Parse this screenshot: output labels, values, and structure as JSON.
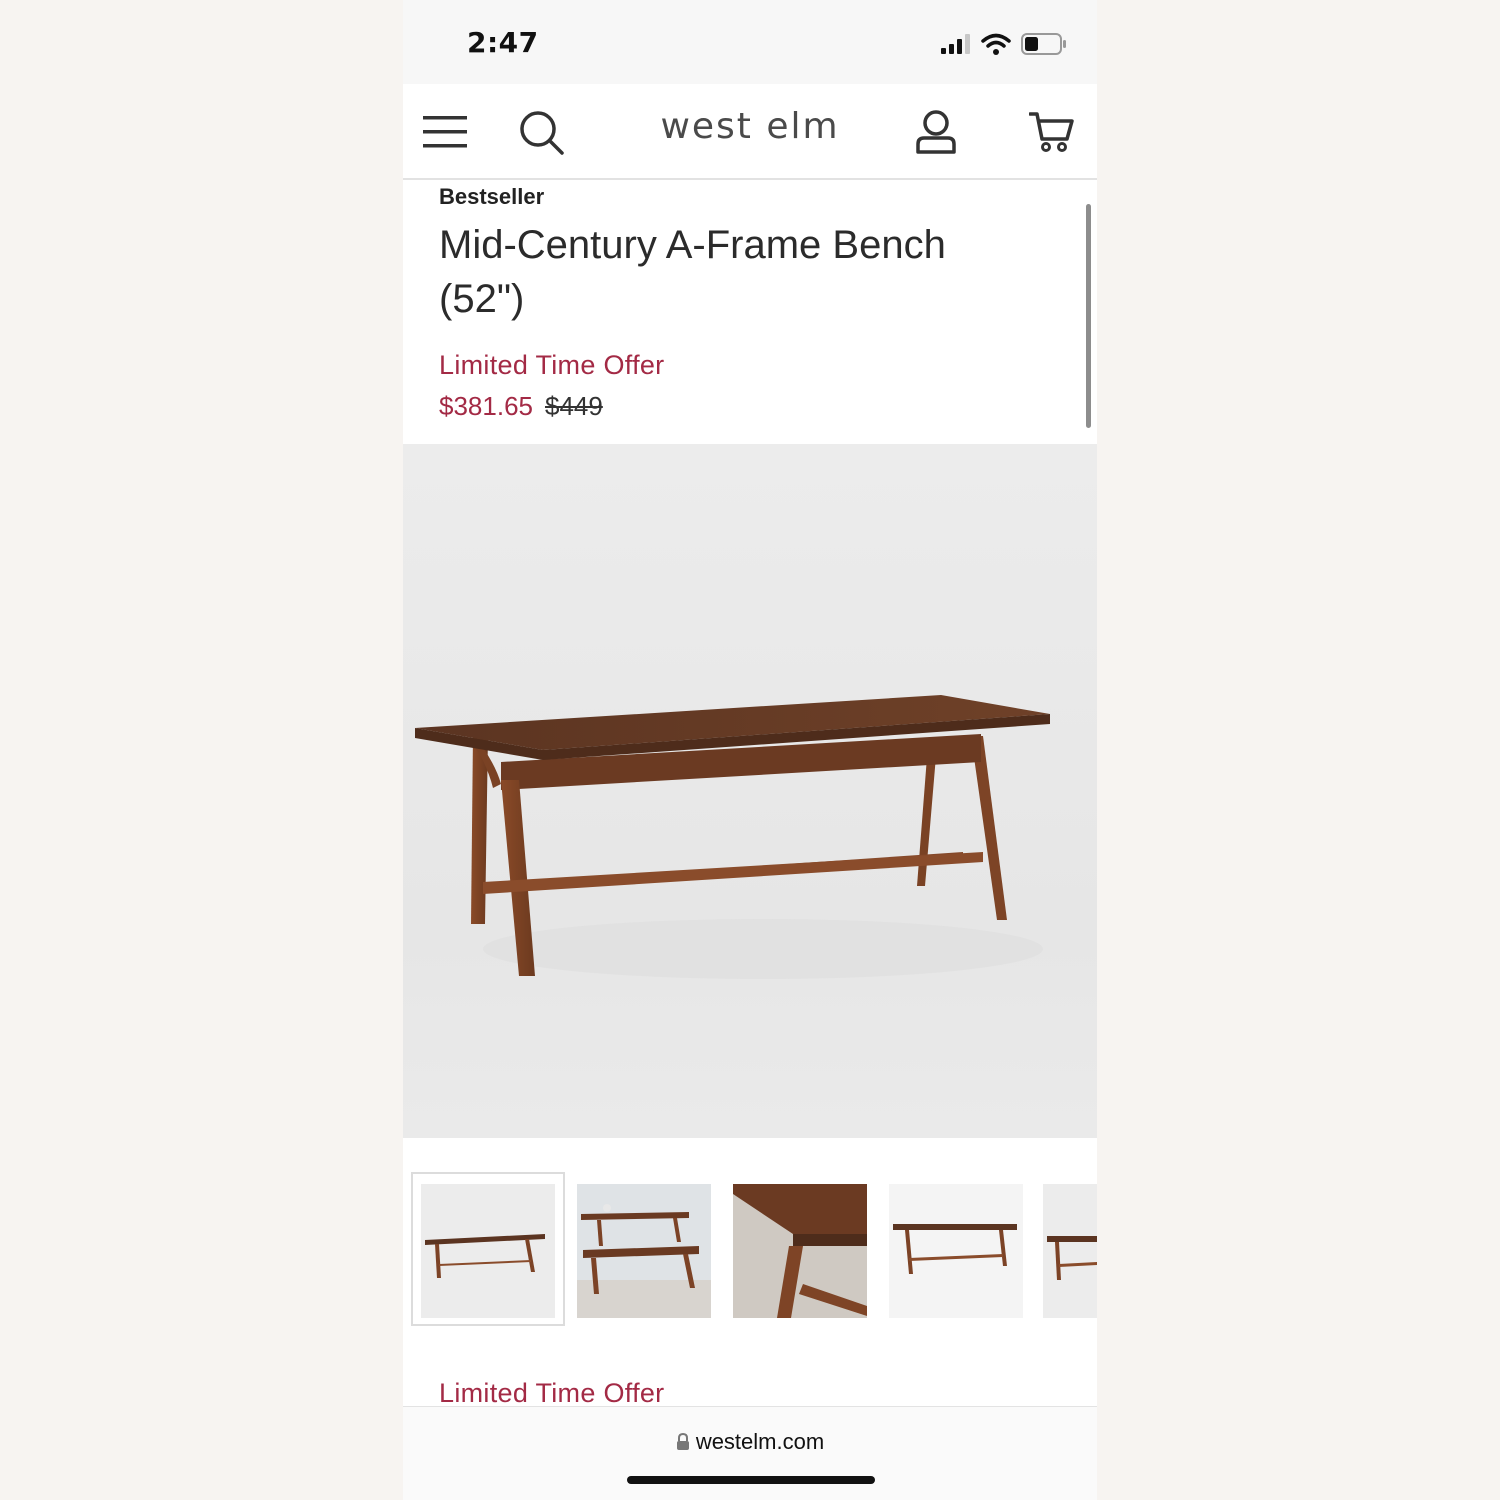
{
  "status_bar": {
    "time": "2:47",
    "icons": [
      "signal-icon",
      "wifi-icon",
      "battery-icon"
    ]
  },
  "nav": {
    "logo": "west elm",
    "icons": [
      "menu-icon",
      "search-icon",
      "account-icon",
      "cart-icon"
    ]
  },
  "product": {
    "badge": "Bestseller",
    "title_line1": "Mid-Century A-Frame Bench",
    "title_line2": "(52\")",
    "offer_label": "Limited Time Offer",
    "price_sale": "$381.65",
    "price_original": "$449"
  },
  "gallery": {
    "thumbnail_count": 5,
    "selected_index": 0
  },
  "footer": {
    "offer_label": "Limited Time Offer",
    "url": "westelm.com"
  },
  "colors": {
    "accent": "#a32a45",
    "wood": "#6e3b20",
    "background": "#f7f4f1"
  }
}
